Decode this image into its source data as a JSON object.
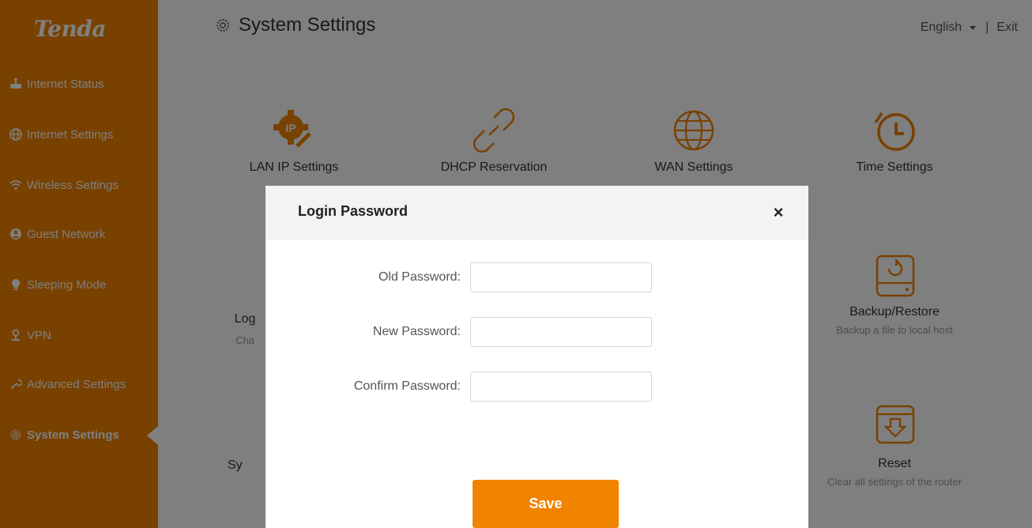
{
  "sidebar": {
    "logo": "Tenda",
    "items": [
      {
        "label": "Internet Status",
        "icon": "router-icon"
      },
      {
        "label": "Internet Settings",
        "icon": "globe-icon"
      },
      {
        "label": "Wireless Settings",
        "icon": "wifi-icon"
      },
      {
        "label": "Guest Network",
        "icon": "guest-icon"
      },
      {
        "label": "Sleeping Mode",
        "icon": "bulb-icon"
      },
      {
        "label": "VPN",
        "icon": "vpn-icon"
      },
      {
        "label": "Advanced Settings",
        "icon": "wrench-icon"
      },
      {
        "label": "System Settings",
        "icon": "gear-icon",
        "active": true
      }
    ]
  },
  "header": {
    "title": "System Settings",
    "language": "English",
    "separator": "|",
    "exit": "Exit"
  },
  "tiles": [
    {
      "label": "LAN IP Settings",
      "icon": "ip-gear-icon"
    },
    {
      "label": "DHCP Reservation",
      "icon": "link-icon"
    },
    {
      "label": "WAN Settings",
      "icon": "globe-icon"
    },
    {
      "label": "Time Settings",
      "icon": "clock-icon"
    },
    {
      "label": "Log",
      "sub": "Cha",
      "partial": true
    },
    {
      "label": "Backup/Restore",
      "sub": "Backup a file to local host",
      "icon": "backup-icon"
    },
    {
      "label": "Sy",
      "partial": true
    },
    {
      "label": "Reset",
      "sub": "Clear all settings of the router",
      "icon": "reset-icon"
    }
  ],
  "modal": {
    "title": "Login Password",
    "close": "×",
    "fields": [
      {
        "label": "Old Password:",
        "value": ""
      },
      {
        "label": "New Password:",
        "value": ""
      },
      {
        "label": "Confirm Password:",
        "value": ""
      }
    ],
    "save_label": "Save"
  },
  "colors": {
    "brand": "#f08300",
    "overlay": "rgba(0,0,0,0.5)"
  }
}
